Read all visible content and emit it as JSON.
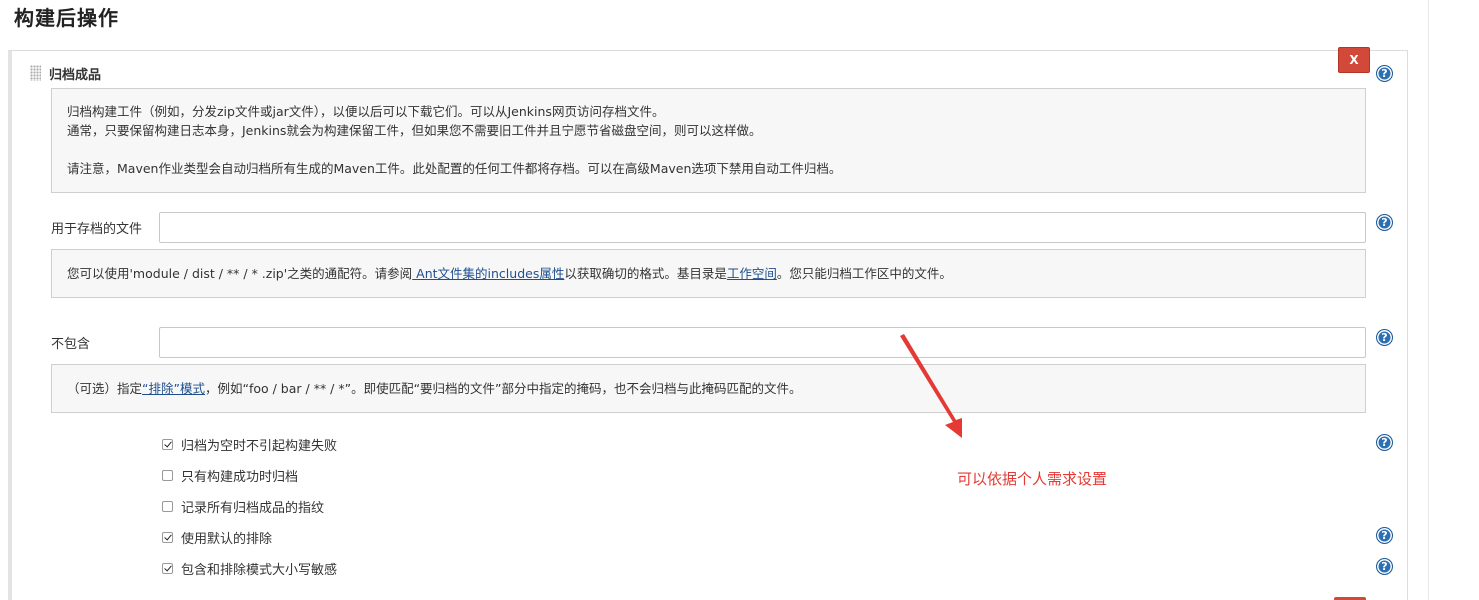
{
  "section_title": "构建后操作",
  "panel": {
    "title": "归档成品",
    "delete_label": "X",
    "help_glyph": "?",
    "intro": {
      "line1": "归档构建工件（例如，分发zip文件或jar文件），以便以后可以下载它们。可以从Jenkins网页访问存档文件。",
      "line2": "通常，只要保留构建日志本身，Jenkins就会为构建保留工件，但如果您不需要旧工件并且宁愿节省磁盘空间，则可以这样做。",
      "line3": "请注意，Maven作业类型会自动归档所有生成的Maven工件。此处配置的任何工件都将存档。可以在高级Maven选项下禁用自动工件归档。"
    },
    "artifacts_field": {
      "label": "用于存档的文件",
      "value": "",
      "help_pre": "您可以使用'module / dist / ** / * .zip'之类的通配符。请参阅",
      "help_link1": " Ant文件集的includes属性",
      "help_mid": "以获取确切的格式。基目录是",
      "help_link2": "工作空间",
      "help_post": "。您只能归档工作区中的文件。"
    },
    "excludes_field": {
      "label": "不包含",
      "value": "",
      "help_pre": "（可选）指定",
      "help_link": "“排除”模式",
      "help_post": "，例如“foo / bar / ** / *”。即使匹配“要归档的文件”部分中指定的掩码，也不会归档与此掩码匹配的文件。"
    },
    "options": [
      {
        "label": "归档为空时不引起构建失败",
        "checked": true
      },
      {
        "label": "只有构建成功时归档",
        "checked": false
      },
      {
        "label": "记录所有归档成品的指纹",
        "checked": false
      },
      {
        "label": "使用默认的排除",
        "checked": true
      },
      {
        "label": "包含和排除模式大小写敏感",
        "checked": true
      }
    ]
  },
  "annotation": {
    "text": "可以依据个人需求设置",
    "color": "#e53935"
  }
}
